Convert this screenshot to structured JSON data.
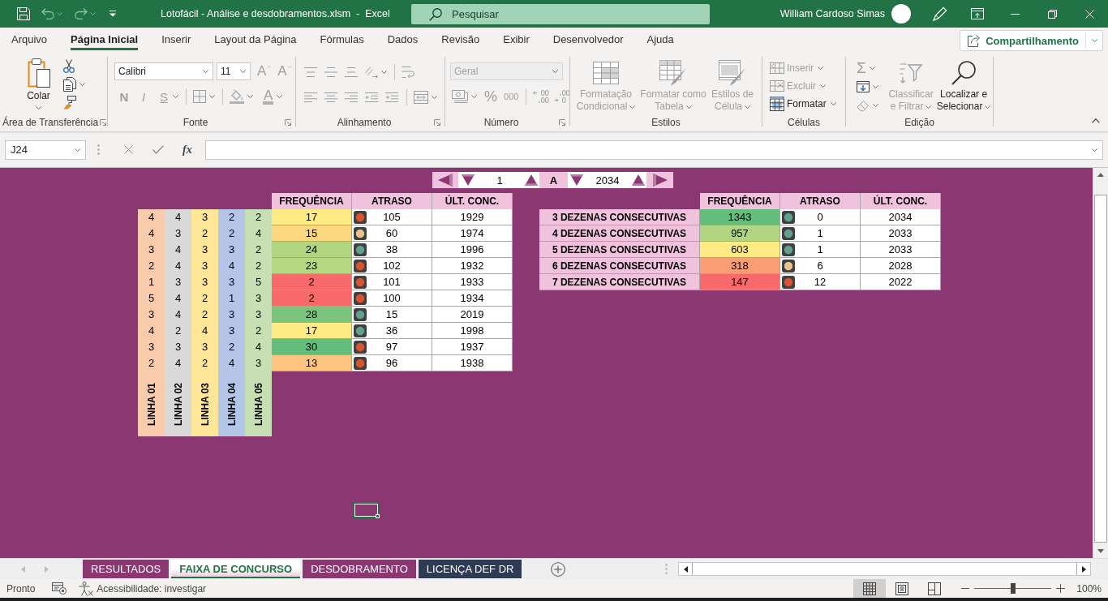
{
  "window": {
    "title": "Lotofácil - Análise e desdobramentos.xlsm  -  Excel",
    "user": "William Cardoso Simas"
  },
  "search": {
    "placeholder": "Pesquisar"
  },
  "menu_tabs": [
    {
      "label": "Arquivo",
      "selected": false
    },
    {
      "label": "Página Inicial",
      "selected": true
    },
    {
      "label": "Inserir",
      "selected": false
    },
    {
      "label": "Layout da Página",
      "selected": false
    },
    {
      "label": "Fórmulas",
      "selected": false
    },
    {
      "label": "Dados",
      "selected": false
    },
    {
      "label": "Revisão",
      "selected": false
    },
    {
      "label": "Exibir",
      "selected": false
    },
    {
      "label": "Desenvolvedor",
      "selected": false
    },
    {
      "label": "Ajuda",
      "selected": false
    }
  ],
  "share_button": {
    "label": "Compartilhamento"
  },
  "ribbon": {
    "clipboard": {
      "label": "Área de Transferência",
      "paste": "Colar"
    },
    "font": {
      "label": "Fonte",
      "font_name": "Calibri",
      "font_size": "11",
      "size_buttons": [
        {
          "kind": "grow",
          "label": "A",
          "disabled": true
        },
        {
          "kind": "shrink",
          "label": "A",
          "disabled": true
        }
      ],
      "style_buttons": [
        {
          "kind": "bold",
          "label": "N",
          "disabled": true
        },
        {
          "kind": "italic",
          "label": "I",
          "disabled": true
        },
        {
          "kind": "underline",
          "label": "S",
          "disabled": true
        }
      ],
      "font_color": {
        "label": "A",
        "disabled": true
      }
    },
    "alignment": {
      "label": "Alinhamento"
    },
    "number": {
      "label": "Número",
      "format": {
        "value": "Geral",
        "disabled": true
      },
      "buttons": [
        {
          "kind": "percent",
          "label": "%",
          "disabled": true
        },
        {
          "kind": "thousands",
          "label": "000",
          "disabled": true
        }
      ]
    },
    "styles": {
      "label": "Estilos",
      "commands": [
        {
          "kind": "conditional_formatting",
          "label": "Formatação Condicional",
          "disabled": true
        },
        {
          "kind": "format_as_table",
          "label": "Formatar como Tabela",
          "disabled": true
        },
        {
          "kind": "cell_styles",
          "label": "Estilos de Célula",
          "disabled": true
        }
      ]
    },
    "cells": {
      "label": "Células",
      "commands": [
        {
          "kind": "insert",
          "label": "Inserir",
          "disabled": true
        },
        {
          "kind": "delete",
          "label": "Excluir",
          "disabled": true
        },
        {
          "kind": "format",
          "label": "Formatar",
          "disabled": false
        }
      ]
    },
    "editing": {
      "label": "Edição",
      "autosum": {
        "label": "Σ",
        "disabled": true
      },
      "commands": [
        {
          "kind": "sort_filter",
          "label": "Classificar e Filtrar",
          "disabled": true
        },
        {
          "kind": "find",
          "label": "Localizar e Selecionar",
          "disabled": false
        }
      ]
    }
  },
  "formula_bar": {
    "name_box": "J24",
    "function_label": "fx"
  },
  "sheet": {
    "range_selector": {
      "start": "1",
      "separator": "A",
      "end": "2034"
    },
    "line_table": {
      "columns": [
        {
          "label": "LINHA 01",
          "color": "#f8cbad",
          "values": [
            "4",
            "4",
            "3",
            "2",
            "1",
            "5",
            "3",
            "4",
            "3",
            "2"
          ]
        },
        {
          "label": "LINHA 02",
          "color": "#d9d9d9",
          "values": [
            "4",
            "3",
            "4",
            "4",
            "3",
            "4",
            "4",
            "2",
            "3",
            "4"
          ]
        },
        {
          "label": "LINHA 03",
          "color": "#ffe699",
          "values": [
            "3",
            "2",
            "3",
            "3",
            "3",
            "2",
            "2",
            "4",
            "3",
            "2"
          ]
        },
        {
          "label": "LINHA 04",
          "color": "#b4c6e7",
          "values": [
            "2",
            "2",
            "3",
            "4",
            "3",
            "1",
            "3",
            "3",
            "2",
            "4"
          ]
        },
        {
          "label": "LINHA 05",
          "color": "#c6e0b4",
          "values": [
            "2",
            "4",
            "2",
            "2",
            "5",
            "3",
            "3",
            "2",
            "4",
            "3"
          ]
        }
      ]
    },
    "frequency_table": {
      "columns": [
        "FREQUÊNCIA",
        "ATRASO",
        "ÚLT. CONC."
      ],
      "rows": [
        {
          "frequency": {
            "value": "17",
            "color": "#ffeb84"
          },
          "delay": {
            "value": "105",
            "color": "#d9532e"
          },
          "last_draw": "1929"
        },
        {
          "frequency": {
            "value": "15",
            "color": "#fed880"
          },
          "delay": {
            "value": "60",
            "color": "#e8c38c"
          },
          "last_draw": "1974"
        },
        {
          "frequency": {
            "value": "24",
            "color": "#b1d580"
          },
          "delay": {
            "value": "38",
            "color": "#5fa08e"
          },
          "last_draw": "1996"
        },
        {
          "frequency": {
            "value": "23",
            "color": "#b5d780"
          },
          "delay": {
            "value": "102",
            "color": "#d9532e"
          },
          "last_draw": "1932"
        },
        {
          "frequency": {
            "value": "2",
            "color": "#f8696b"
          },
          "delay": {
            "value": "101",
            "color": "#d9532e"
          },
          "last_draw": "1933"
        },
        {
          "frequency": {
            "value": "2",
            "color": "#f8696b"
          },
          "delay": {
            "value": "100",
            "color": "#d9532e"
          },
          "last_draw": "1934"
        },
        {
          "frequency": {
            "value": "28",
            "color": "#7cc47d"
          },
          "delay": {
            "value": "15",
            "color": "#5fa08e"
          },
          "last_draw": "2019"
        },
        {
          "frequency": {
            "value": "17",
            "color": "#ffeb84"
          },
          "delay": {
            "value": "36",
            "color": "#5fa08e"
          },
          "last_draw": "1998"
        },
        {
          "frequency": {
            "value": "30",
            "color": "#63be7b"
          },
          "delay": {
            "value": "97",
            "color": "#d9532e"
          },
          "last_draw": "1937"
        },
        {
          "frequency": {
            "value": "13",
            "color": "#fdc57d"
          },
          "delay": {
            "value": "96",
            "color": "#d9532e"
          },
          "last_draw": "1938"
        }
      ]
    },
    "consecutive_table": {
      "columns": [
        "FREQUÊNCIA",
        "ATRASO",
        "ÚLT. CONC."
      ],
      "rows": [
        {
          "label": "3 DEZENAS CONSECUTIVAS",
          "frequency": {
            "value": "1343",
            "color": "#63be7b"
          },
          "delay": {
            "value": "0",
            "color": "#5fa08e"
          },
          "last_draw": "2034"
        },
        {
          "label": "4 DEZENAS CONSECUTIVAS",
          "frequency": {
            "value": "957",
            "color": "#b1d580"
          },
          "delay": {
            "value": "1",
            "color": "#5fa08e"
          },
          "last_draw": "2033"
        },
        {
          "label": "5 DEZENAS CONSECUTIVAS",
          "frequency": {
            "value": "603",
            "color": "#ffeb84"
          },
          "delay": {
            "value": "1",
            "color": "#5fa08e"
          },
          "last_draw": "2033"
        },
        {
          "label": "6 DEZENAS CONSECUTIVAS",
          "frequency": {
            "value": "318",
            "color": "#fa9d75"
          },
          "delay": {
            "value": "6",
            "color": "#e8c38c"
          },
          "last_draw": "2028"
        },
        {
          "label": "7 DEZENAS CONSECUTIVAS",
          "frequency": {
            "value": "147",
            "color": "#f8696b"
          },
          "delay": {
            "value": "12",
            "color": "#d9532e"
          },
          "last_draw": "2022"
        }
      ]
    }
  },
  "sheet_tabs": [
    {
      "label": "RESULTADOS",
      "selected": false,
      "color": "#8a3772"
    },
    {
      "label": "FAIXA DE CONCURSO",
      "selected": true
    },
    {
      "label": "DESDOBRAMENTO",
      "selected": false,
      "color": "#8a3772"
    },
    {
      "label": "LICENÇA DEF DR",
      "selected": false,
      "color": "#2f3b55"
    }
  ],
  "status_bar": {
    "status": "Pronto",
    "accessibility": "Acessibilidade: investigar",
    "views": [
      {
        "kind": "normal",
        "selected": true
      },
      {
        "kind": "page_layout",
        "selected": false
      },
      {
        "kind": "page_break",
        "selected": false
      }
    ],
    "zoom": {
      "level": 0.5,
      "reading": "100%"
    }
  }
}
